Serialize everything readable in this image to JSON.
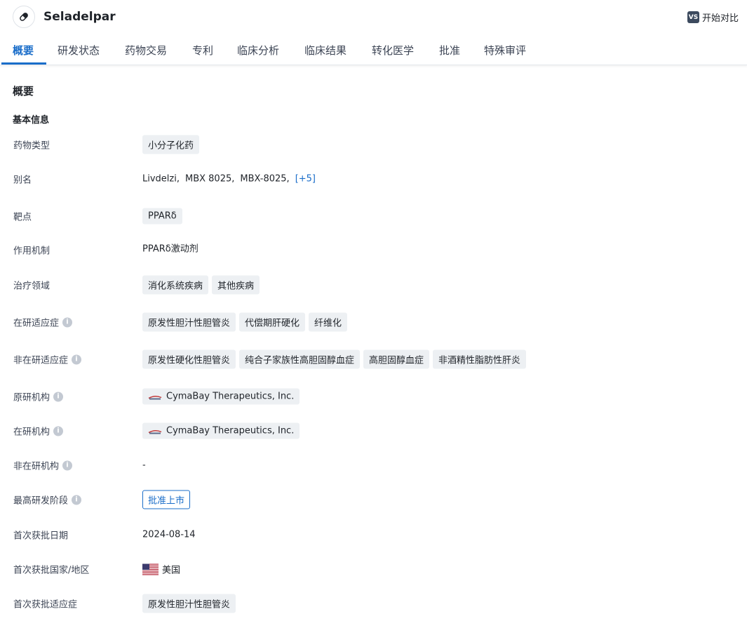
{
  "header": {
    "drug_name": "Seladelpar",
    "compare_label": "开始对比",
    "compare_icon_text": "VS"
  },
  "tabs": [
    {
      "label": "概要",
      "active": true
    },
    {
      "label": "研发状态"
    },
    {
      "label": "药物交易"
    },
    {
      "label": "专利"
    },
    {
      "label": "临床分析"
    },
    {
      "label": "临床结果"
    },
    {
      "label": "转化医学"
    },
    {
      "label": "批准"
    },
    {
      "label": "特殊审评"
    }
  ],
  "section": {
    "title": "概要",
    "subtitle": "基本信息"
  },
  "fields": {
    "drug_type": {
      "label": "药物类型",
      "tags": [
        "小分子化药"
      ]
    },
    "aliases": {
      "label": "别名",
      "values": [
        "Livdelzi,",
        "MBX 8025,",
        "MBX-8025,"
      ],
      "more": "[+5]"
    },
    "target": {
      "label": "靶点",
      "tags": [
        "PPARδ"
      ]
    },
    "mechanism": {
      "label": "作用机制",
      "value": "PPARδ激动剂"
    },
    "therapeutic_area": {
      "label": "治疗领域",
      "tags": [
        "消化系统疾病",
        "其他疾病"
      ]
    },
    "active_indications": {
      "label": "在研适应症",
      "tags": [
        "原发性胆汁性胆管炎",
        "代偿期肝硬化",
        "纤维化"
      ]
    },
    "inactive_indications": {
      "label": "非在研适应症",
      "tags": [
        "原发性硬化性胆管炎",
        "纯合子家族性高胆固醇血症",
        "高胆固醇血症",
        "非酒精性脂肪性肝炎"
      ]
    },
    "originator": {
      "label": "原研机构",
      "org": "CymaBay Therapeutics, Inc."
    },
    "active_org": {
      "label": "在研机构",
      "org": "CymaBay Therapeutics, Inc."
    },
    "inactive_org": {
      "label": "非在研机构",
      "value": "-"
    },
    "highest_phase": {
      "label": "最高研发阶段",
      "badge": "批准上市"
    },
    "first_approval_date": {
      "label": "首次获批日期",
      "value": "2024-08-14"
    },
    "first_approval_country": {
      "label": "首次获批国家/地区",
      "value": "美国"
    },
    "first_approval_indication": {
      "label": "首次获批适应症",
      "tags": [
        "原发性胆汁性胆管炎"
      ]
    }
  },
  "colors": {
    "accent": "#1a6dc9",
    "tag_bg": "#edf0f3",
    "info_icon": "#c3c9d2"
  },
  "icons": {
    "drug": "pill-icon",
    "info": "info-icon",
    "org_logo": "company-logo-icon",
    "flag": "us-flag-icon"
  }
}
